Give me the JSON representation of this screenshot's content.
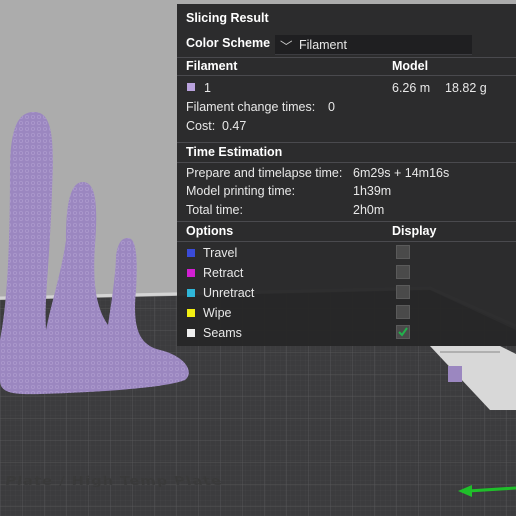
{
  "panel": {
    "title": "Slicing Result",
    "color_scheme_label": "Color Scheme",
    "color_scheme_value": "Filament"
  },
  "filament": {
    "header": "Filament",
    "model_header": "Model",
    "item": {
      "name": "1",
      "color": "#b9a2dd",
      "length": "6.26 m",
      "weight": "18.82 g"
    },
    "change_times_label": "Filament change times:",
    "change_times_value": "0",
    "cost_label": "Cost:",
    "cost_value": "0.47"
  },
  "time": {
    "header": "Time Estimation",
    "rows": [
      {
        "label": "Prepare and timelapse time:",
        "value": "6m29s + 14m16s"
      },
      {
        "label": "Model printing time:",
        "value": "1h39m"
      },
      {
        "label": "Total time:",
        "value": "2h0m"
      }
    ]
  },
  "options": {
    "header": "Options",
    "display_header": "Display",
    "items": [
      {
        "label": "Travel",
        "color": "#3a4bd8",
        "checked": false
      },
      {
        "label": "Retract",
        "color": "#d21fd2",
        "checked": false
      },
      {
        "label": "Unretract",
        "color": "#2fb6d8",
        "checked": false
      },
      {
        "label": "Wipe",
        "color": "#f2ef13",
        "checked": false
      },
      {
        "label": "Seams",
        "color": "#efefef",
        "checked": true
      }
    ]
  },
  "plate": {
    "label": "Plate / High Temp Plate"
  },
  "colors": {
    "model": "#9b87c0",
    "bed": "#3c3c3e",
    "check_accent": "#22b14c"
  }
}
